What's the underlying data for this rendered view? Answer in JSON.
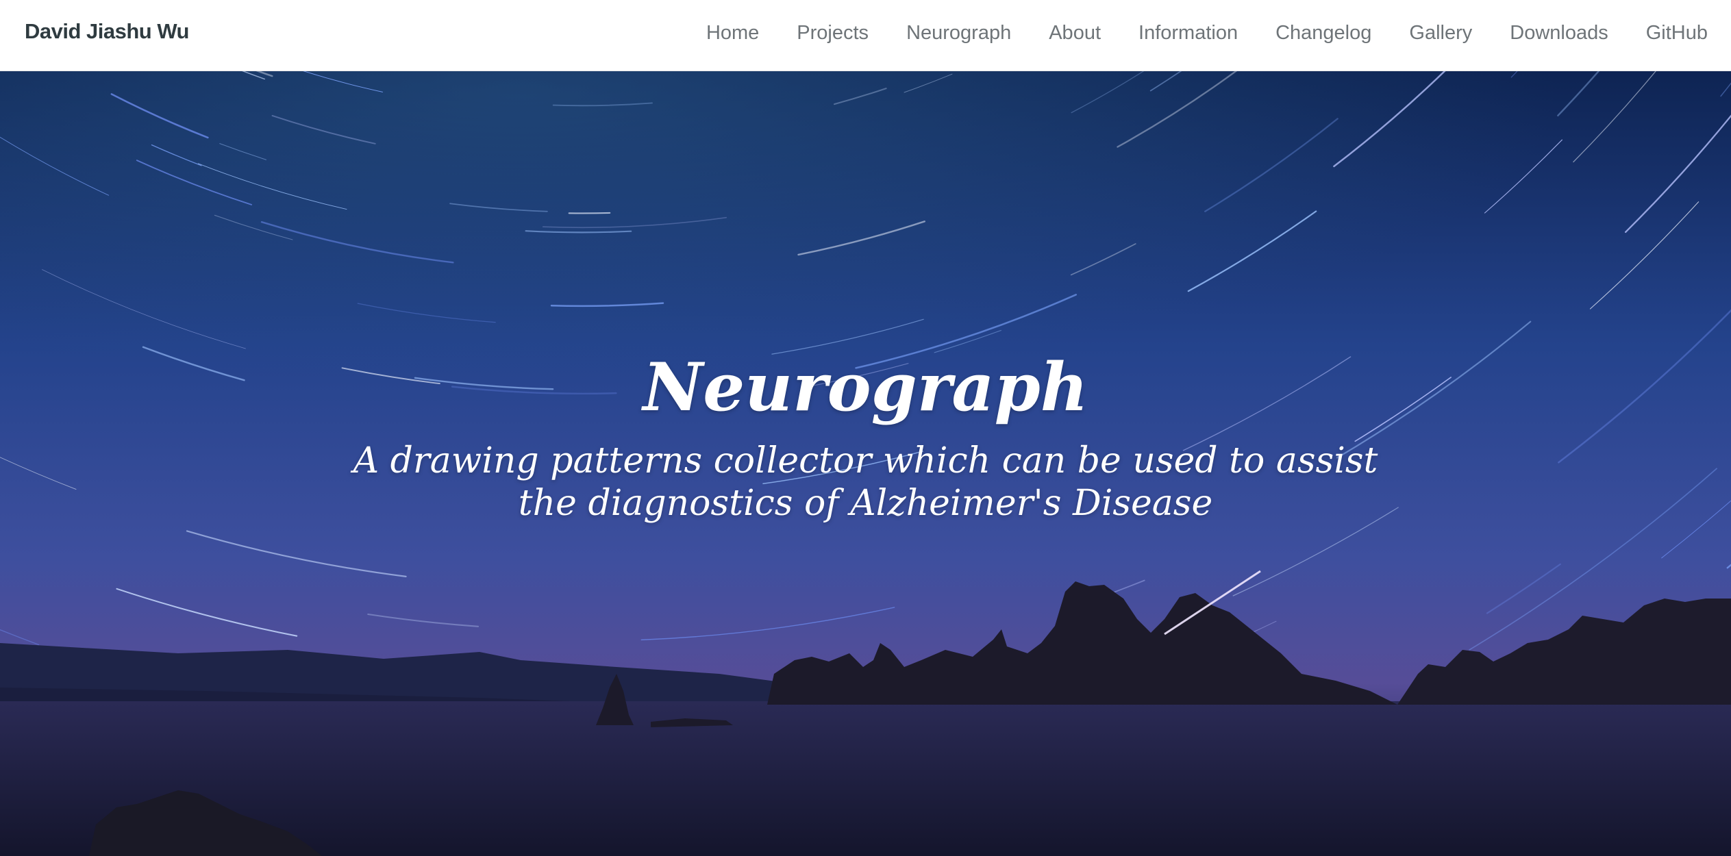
{
  "navbar": {
    "brand": "David Jiashu Wu",
    "links": [
      {
        "label": "Home"
      },
      {
        "label": "Projects"
      },
      {
        "label": "Neurograph"
      },
      {
        "label": "About"
      },
      {
        "label": "Information"
      },
      {
        "label": "Changelog"
      },
      {
        "label": "Gallery"
      },
      {
        "label": "Downloads"
      },
      {
        "label": "GitHub"
      }
    ]
  },
  "hero": {
    "title": "Neurograph",
    "subtitle": "A drawing patterns collector which can be used to assist the diagnostics of Alzheimer's Disease",
    "background_image": "star-trails-over-lake-with-rock-formations-photo"
  },
  "colors": {
    "sky_top": "#0f2a5a",
    "sky_mid": "#2d4a9a",
    "sky_low": "#5a4e9e",
    "water": "#1b1d3d",
    "text_white": "#ffffff",
    "nav_text": "#6e7478",
    "brand_text": "#2f3b40"
  }
}
